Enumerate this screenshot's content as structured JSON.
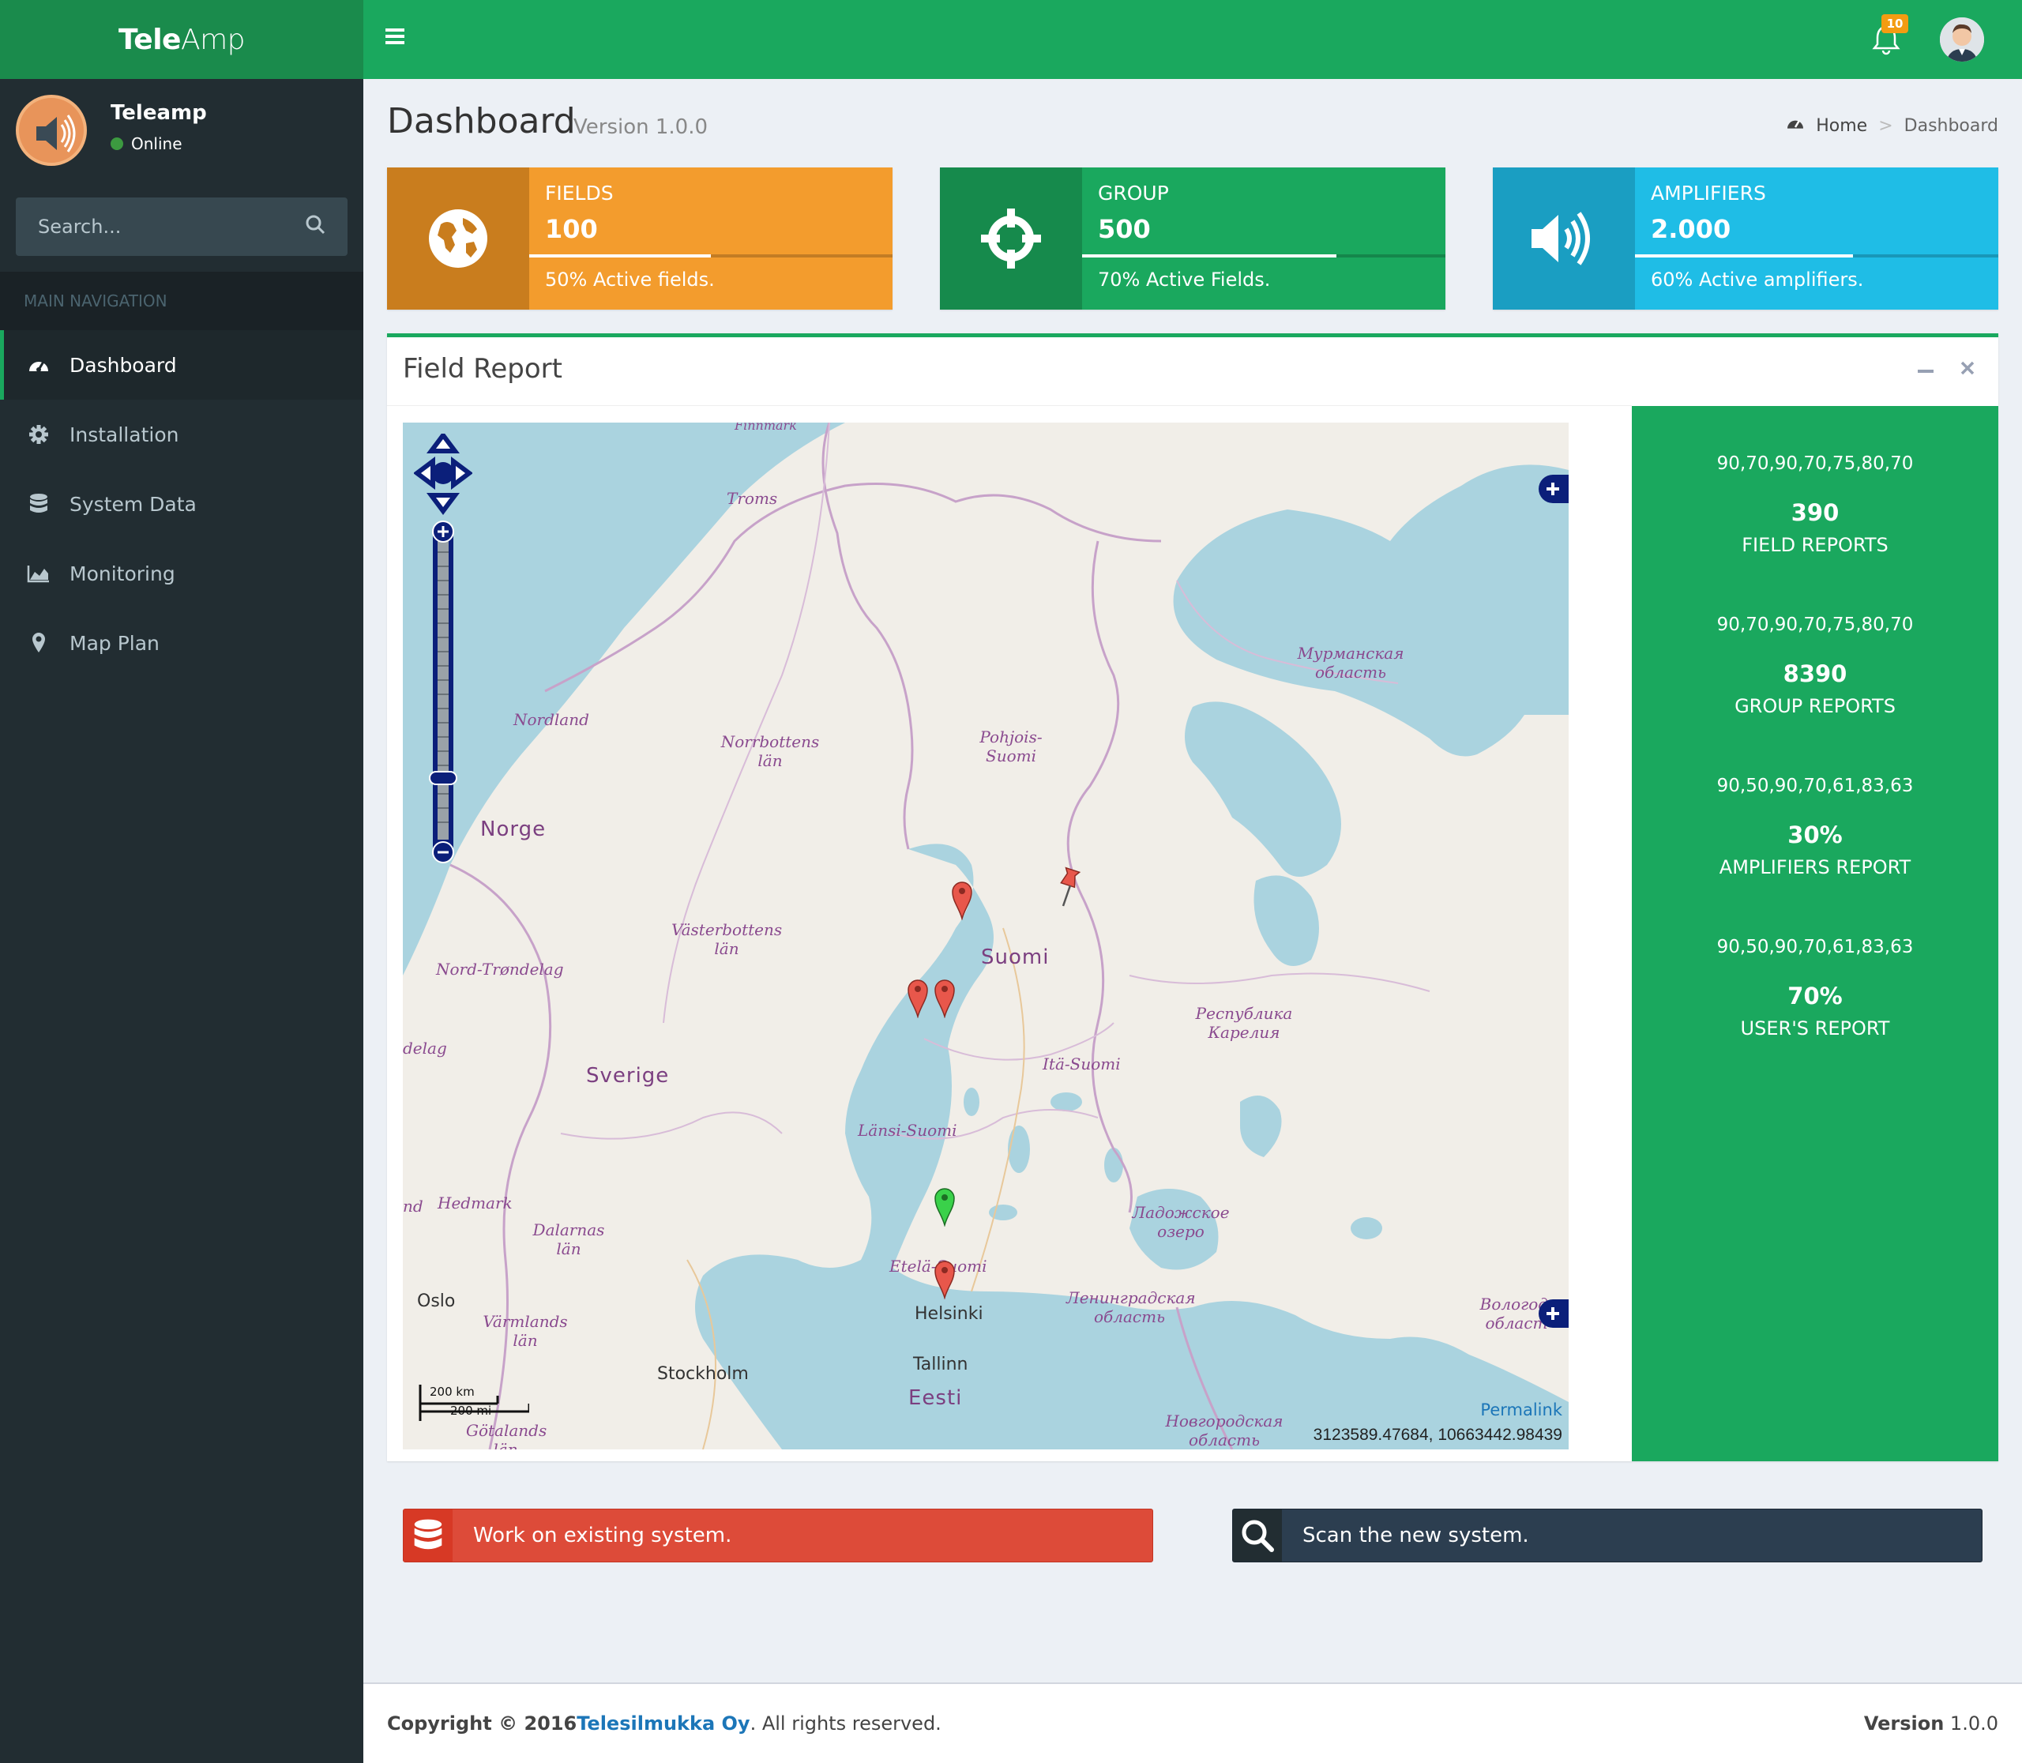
{
  "app": {
    "logo_bold": "Tele",
    "logo_light": "Amp"
  },
  "user": {
    "name": "Teleamp",
    "status": "Online"
  },
  "search": {
    "placeholder": "Search..."
  },
  "nav": {
    "header": "MAIN NAVIGATION",
    "items": [
      {
        "label": "Dashboard",
        "icon": "dashboard-icon",
        "active": true
      },
      {
        "label": "Installation",
        "icon": "gear-icon"
      },
      {
        "label": "System Data",
        "icon": "database-icon"
      },
      {
        "label": "Monitoring",
        "icon": "area-chart-icon"
      },
      {
        "label": "Map Plan",
        "icon": "map-marker-icon"
      }
    ]
  },
  "header": {
    "notification_count": "10"
  },
  "page": {
    "title": "Dashboard",
    "subtitle": "Version 1.0.0"
  },
  "breadcrumb": {
    "home": "Home",
    "current": "Dashboard"
  },
  "info_boxes": [
    {
      "label": "FIELDS",
      "value": "100",
      "desc": "50% Active fields.",
      "progress": 0.5,
      "icon": "globe-icon",
      "color": "#f39c2d",
      "icon_bg": "#c97d1e"
    },
    {
      "label": "GROUP",
      "value": "500",
      "desc": "70% Active Fields.",
      "progress": 0.7,
      "icon": "crosshairs-icon",
      "color": "#1aa85e",
      "icon_bg": "#168a4c"
    },
    {
      "label": "AMPLIFIERS",
      "value": "2.000",
      "desc": "60% Active amplifiers.",
      "progress": 0.6,
      "icon": "volume-icon",
      "color": "#1fbde6",
      "icon_bg": "#1a9ec2"
    }
  ],
  "report": {
    "title": "Field Report",
    "stats": [
      {
        "spark": "90,70,90,70,75,80,70",
        "value": "390",
        "label": "FIELD REPORTS"
      },
      {
        "spark": "90,70,90,70,75,80,70",
        "value": "8390",
        "label": "GROUP REPORTS"
      },
      {
        "spark": "90,50,90,70,61,83,63",
        "value": "30%",
        "label": "AMPLIFIERS REPORT"
      },
      {
        "spark": "90,50,90,70,61,83,63",
        "value": "70%",
        "label": "USER'S REPORT"
      }
    ]
  },
  "map": {
    "permalink": "Permalink",
    "coords": "3123589.47684, 10663442.98439",
    "scale_km": "200 km",
    "scale_mi": "200 mi",
    "labels": {
      "troms": "Troms",
      "nordland": "Nordland",
      "norrbotten": "Norrbottens län",
      "pohjois": "Pohjois-Suomi",
      "murmansk": "Мурманская область",
      "norge": "Norge",
      "vasterbotten": "Västerbottens län",
      "nordtrondelag": "Nord-Trøndelag",
      "suomi": "Suomi",
      "karelia": "Республика Карелия",
      "sverige": "Sverige",
      "itasuomi": "Itä-Suomi",
      "lansisuomi": "Länsi-Suomi",
      "hedmark": "Hedmark",
      "dalarnas": "Dalarnas län",
      "ladoga": "Ладожское озеро",
      "etelasuomi": "Etelä-Suomi",
      "oslo": "Oslo",
      "varmlands": "Värmlands län",
      "helsinki": "Helsinki",
      "leningrad": "Ленинградская область",
      "vologda": "Вологод. област",
      "stockholm": "Stockholm",
      "tallinn": "Tallinn",
      "eesti": "Eesti",
      "novgorod": "Новгородская область",
      "gotalands": "Götalands län",
      "finnmark": "Finnmark",
      "delag": "delag",
      "nd": "nd"
    }
  },
  "actions": [
    {
      "label": "Work on existing system.",
      "icon": "database-icon",
      "color": "#dd4b39",
      "icon_bg": "#d73925"
    },
    {
      "label": "Scan the new system.",
      "icon": "search-icon",
      "color": "#2c3e50",
      "icon_bg": "#222d32"
    }
  ],
  "footer": {
    "copyright": "Copyright © 2016",
    "company": "Telesilmukka Oy",
    "rights": ". All rights reserved.",
    "version_label": "Version",
    "version": "1.0.0"
  }
}
